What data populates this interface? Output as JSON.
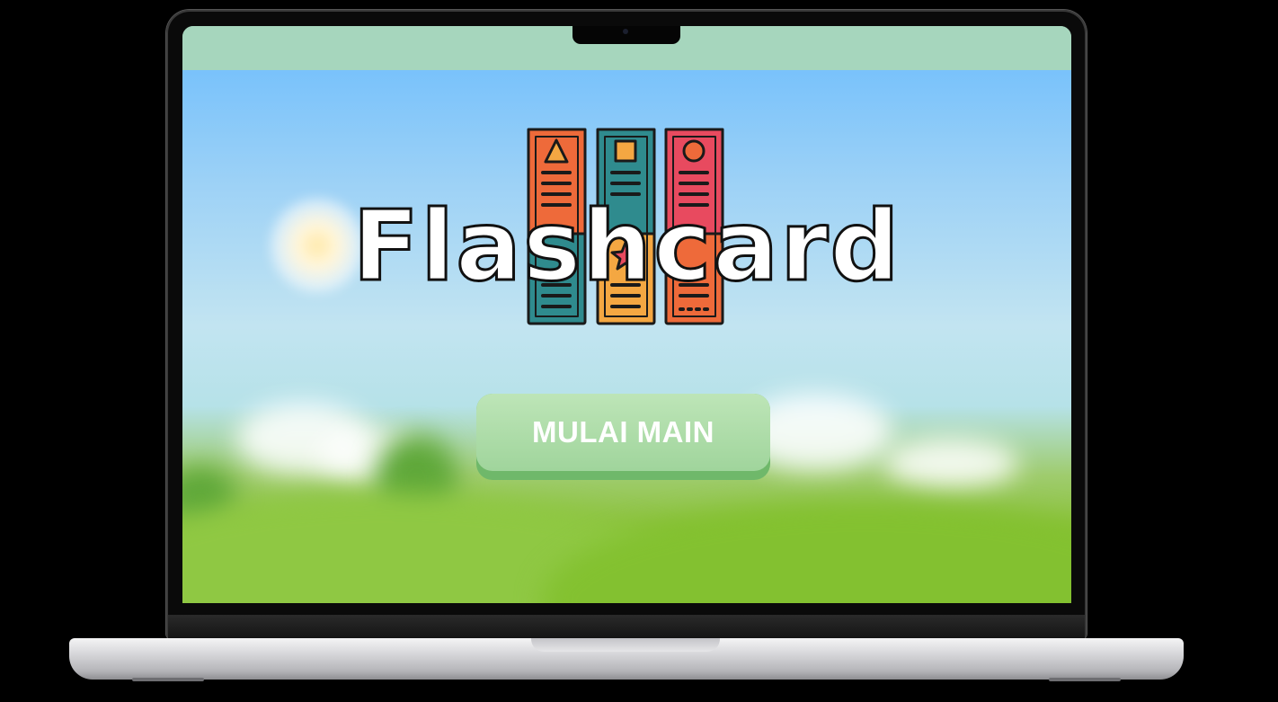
{
  "app": {
    "title": "Flashcard",
    "start_button_label": "MULAI MAIN"
  },
  "colors": {
    "topbar": "#a6d6bd",
    "sky_top": "#79c2fb",
    "grass": "#7fbf27",
    "button": "#a4d7a0",
    "button_shadow": "#6fb86a"
  },
  "icons": {
    "logo": "card-binders-icon"
  }
}
